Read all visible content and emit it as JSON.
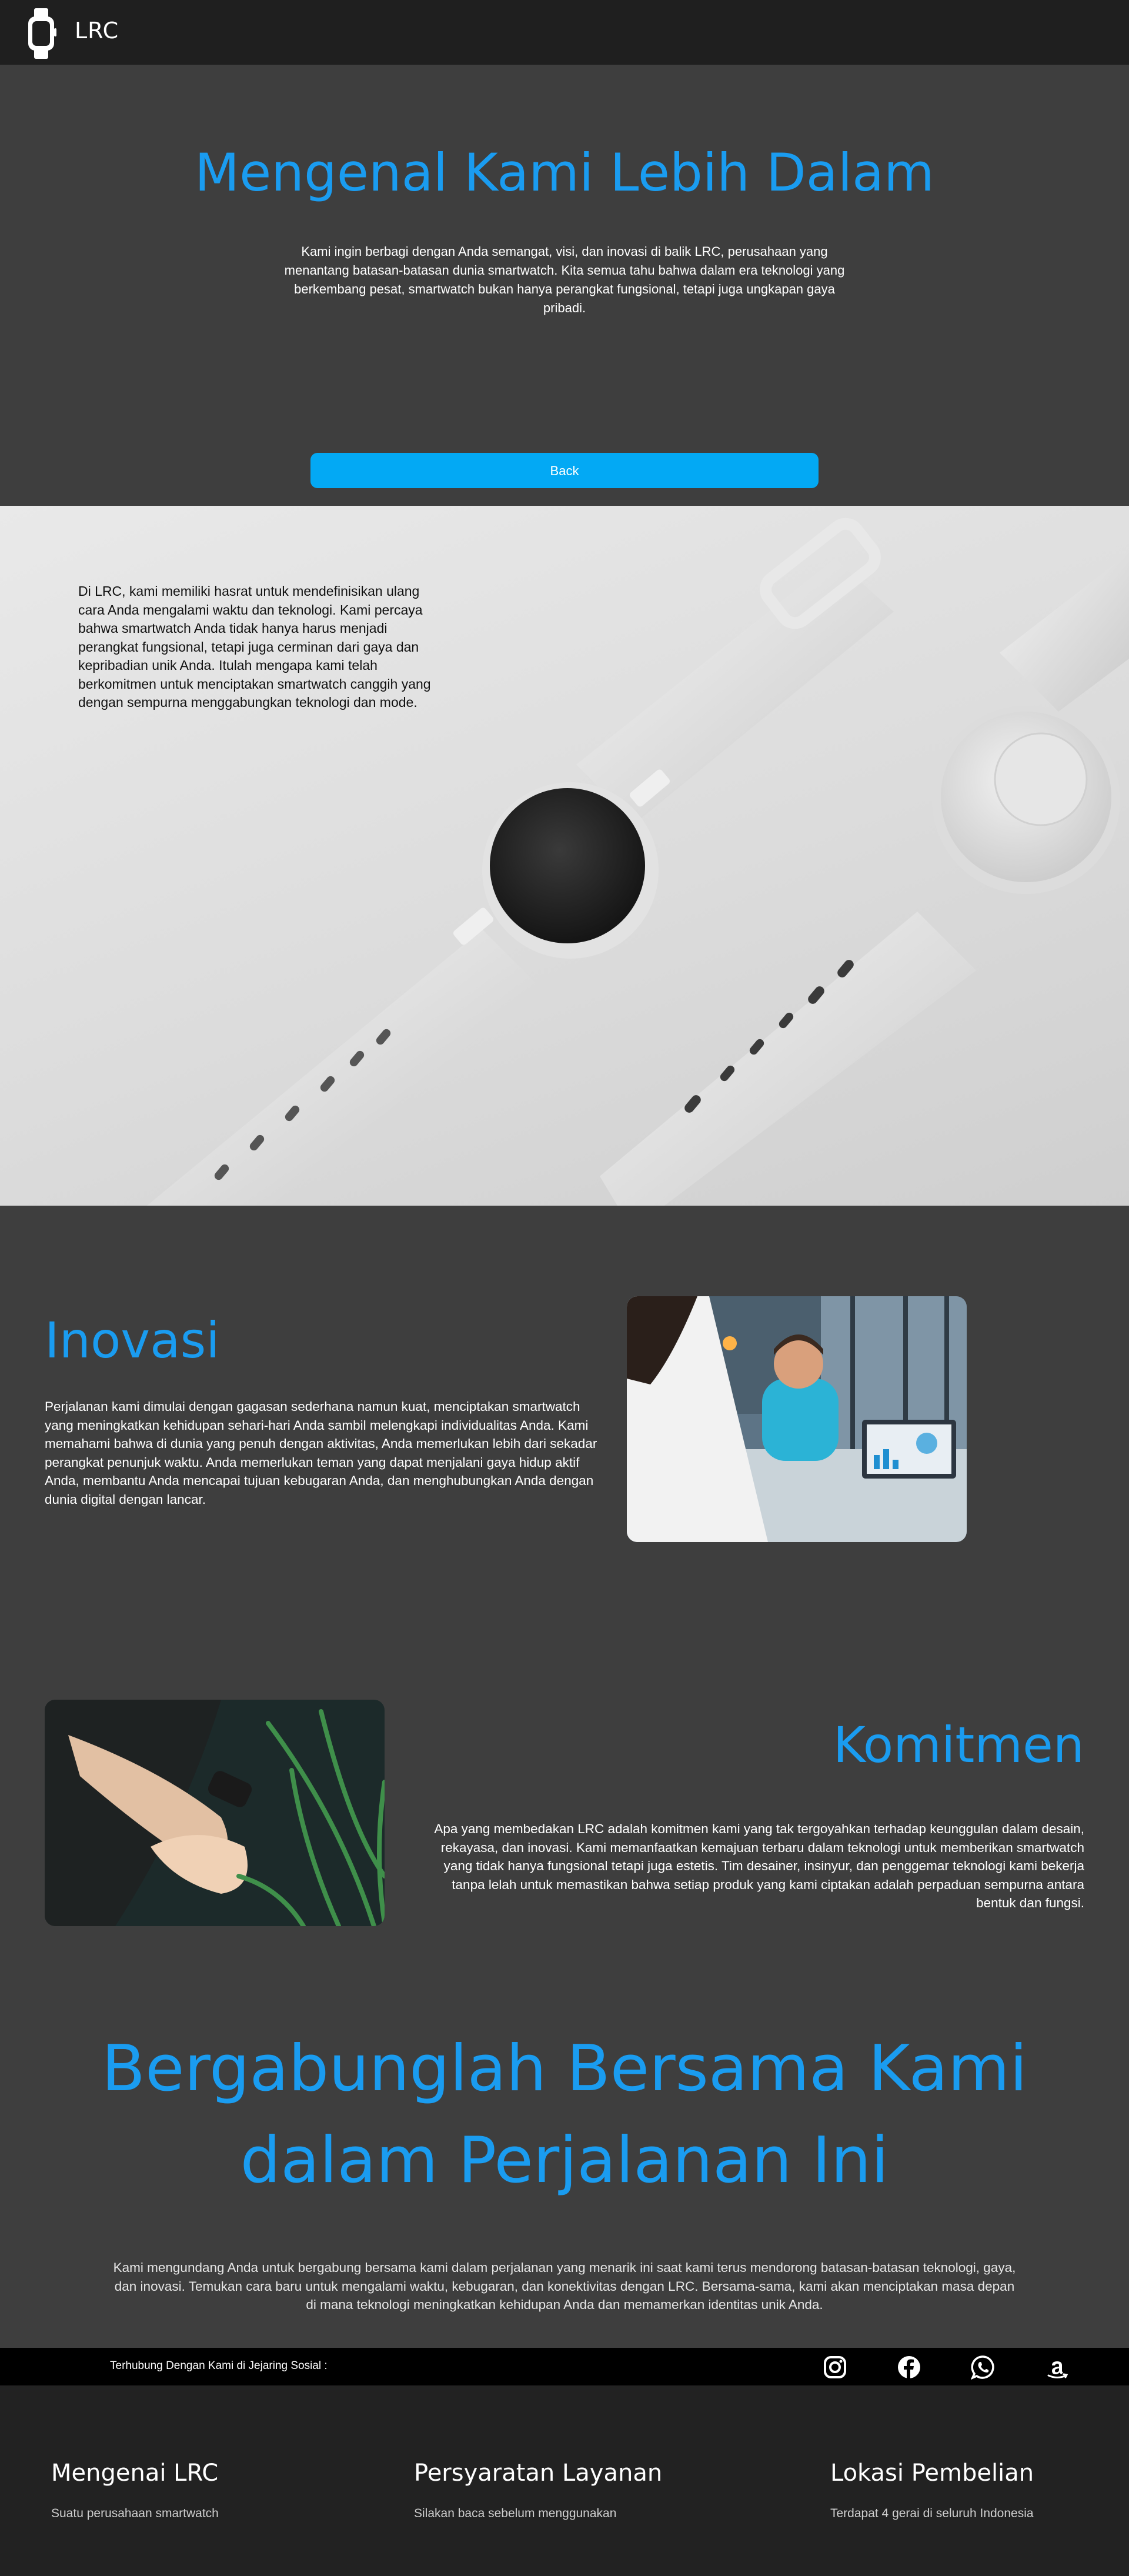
{
  "navbar": {
    "brand": "LRC",
    "logo_icon": "smartwatch-icon"
  },
  "hero": {
    "title": "Mengenal Kami Lebih Dalam",
    "text": "Kami ingin berbagi dengan Anda semangat, visi, dan inovasi di balik LRC, perusahaan yang menantang batasan-batasan dunia smartwatch. Kita semua tahu bahwa dalam era teknologi yang berkembang pesat, smartwatch bukan hanya perangkat fungsional, tetapi juga ungkapan gaya pribadi.",
    "back_label": "Back"
  },
  "watch_section": {
    "text": "Di LRC, kami memiliki hasrat untuk mendefinisikan ulang cara Anda mengalami waktu dan teknologi. Kami percaya bahwa smartwatch Anda tidak hanya harus menjadi perangkat fungsional, tetapi juga cerminan dari gaya dan kepribadian unik Anda. Itulah mengapa kami telah berkomitmen untuk menciptakan smartwatch canggih yang dengan sempurna menggabungkan teknologi dan mode."
  },
  "inovasi": {
    "title": "Inovasi",
    "text": "Perjalanan kami dimulai dengan gagasan sederhana namun kuat, menciptakan smartwatch yang meningkatkan kehidupan sehari-hari Anda sambil melengkapi individualitas Anda. Kami memahami bahwa di dunia yang penuh dengan aktivitas, Anda memerlukan lebih dari sekadar perangkat penunjuk waktu. Anda memerlukan teman yang dapat menjalani gaya hidup aktif Anda, membantu Anda mencapai tujuan kebugaran Anda, dan menghubungkan Anda dengan dunia digital dengan lancar."
  },
  "komitmen": {
    "title": "Komitmen",
    "text": "Apa yang membedakan LRC adalah komitmen kami yang tak tergoyahkan terhadap keunggulan dalam desain, rekayasa, dan inovasi. Kami memanfaatkan kemajuan terbaru dalam teknologi untuk memberikan smartwatch yang tidak hanya fungsional tetapi juga estetis. Tim desainer, insinyur, dan penggemar teknologi kami bekerja tanpa lelah untuk memastikan bahwa setiap produk yang kami ciptakan adalah perpaduan sempurna antara bentuk dan fungsi."
  },
  "join": {
    "title_line1": "Bergabunglah Bersama Kami",
    "title_line2": "dalam Perjalanan Ini",
    "text": "Kami mengundang Anda untuk bergabung bersama kami dalam perjalanan yang menarik ini saat kami terus mendorong batasan-batasan teknologi, gaya, dan inovasi. Temukan cara baru untuk mengalami waktu, kebugaran, dan konektivitas dengan LRC. Bersama-sama, kami akan menciptakan masa depan di mana teknologi meningkatkan kehidupan Anda dan memamerkan identitas unik Anda."
  },
  "social": {
    "label": "Terhubung Dengan Kami di Jejaring Sosial :",
    "icons": [
      "instagram-icon",
      "facebook-icon",
      "whatsapp-icon",
      "amazon-icon"
    ]
  },
  "footer": {
    "columns": [
      {
        "title": "Mengenai LRC",
        "text": "Suatu perusahaan smartwatch"
      },
      {
        "title": "Persyaratan Layanan",
        "text": "Silakan baca sebelum menggunakan"
      },
      {
        "title": "Lokasi Pembelian",
        "text": "Terdapat 4 gerai di seluruh Indonesia"
      }
    ]
  },
  "colors": {
    "accent": "#1a9cf0",
    "button": "#03a9f4",
    "nav_bg": "#1f1f1f",
    "page_bg": "#3e3e3e",
    "footer_bg": "#222222"
  }
}
